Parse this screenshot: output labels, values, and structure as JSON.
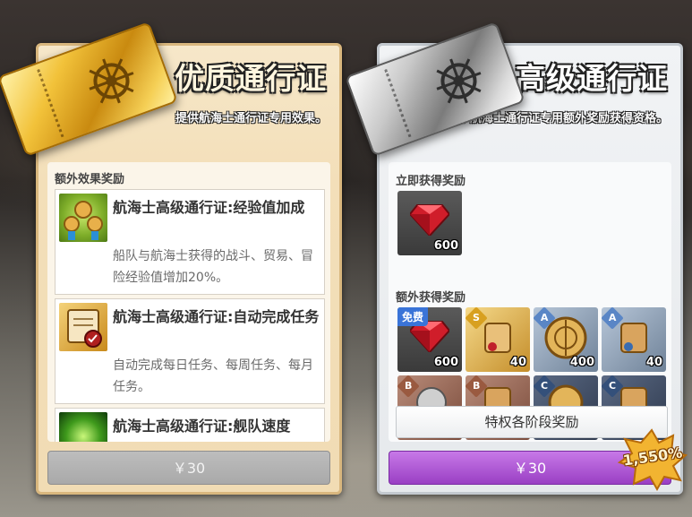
{
  "premium_pass": {
    "title": "优质通行证",
    "subtitle": "提供航海士通行证专用效果。",
    "section_label": "额外效果奖励",
    "rewards": [
      {
        "title": "航海士高级通行证:经验值加成",
        "desc": "船队与航海士获得的战斗、贸易、冒险经验值增加20%。"
      },
      {
        "title": "航海士高级通行证:自动完成任务",
        "desc": "自动完成每日任务、每周任务、每月任务。"
      },
      {
        "title": "航海士高级通行证:舰队速度",
        "desc": ""
      }
    ],
    "price": "￥30"
  },
  "advanced_pass": {
    "title": "高级通行证",
    "subtitle": "赋予航海士通行证专用额外奖励获得资格。",
    "instant_label": "立即获得奖励",
    "instant_items": [
      {
        "icon": "ruby-gem-icon",
        "count": "600"
      }
    ],
    "extra_label": "额外获得奖励",
    "extra_items": [
      {
        "icon": "ruby-gem-icon",
        "count": "600",
        "badge": "免费"
      },
      {
        "icon": "scroll-item-icon",
        "count": "40",
        "grade": "S"
      },
      {
        "icon": "astrolabe-icon",
        "count": "400",
        "grade": "A"
      },
      {
        "icon": "scroll-item-icon",
        "count": "40",
        "grade": "A"
      },
      {
        "icon": "compass-icon",
        "count": "",
        "grade": "B"
      },
      {
        "icon": "scroll-item-icon",
        "count": "",
        "grade": "B"
      },
      {
        "icon": "astrolabe-icon",
        "count": "",
        "grade": "C"
      },
      {
        "icon": "scroll-item-icon",
        "count": "",
        "grade": "C"
      }
    ],
    "stage_button": "特权各阶段奖励",
    "price": "￥30",
    "value_badge": "1,550%"
  },
  "colors": {
    "gold_border": "#d9b77e",
    "silver_border": "#c3c9cf",
    "purchase_purple": "#9a3fc4",
    "disabled_gray": "#a9a9a9"
  }
}
